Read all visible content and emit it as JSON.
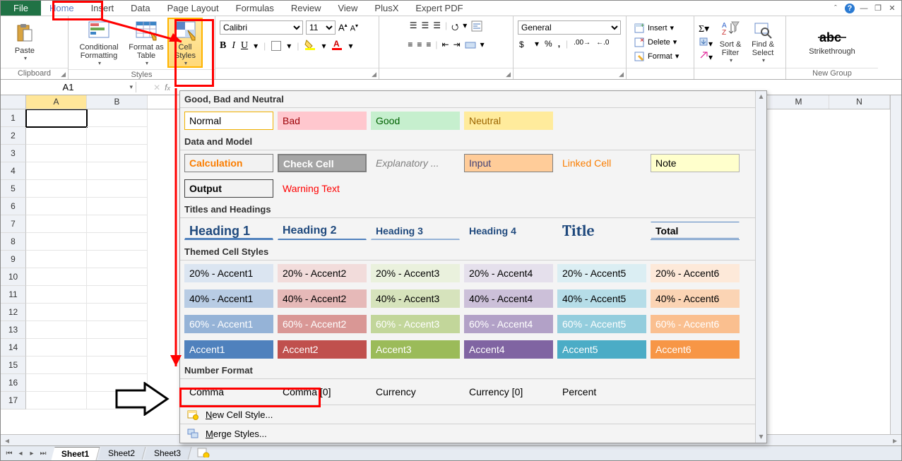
{
  "tabs": {
    "file": "File",
    "items": [
      "Home",
      "Insert",
      "Data",
      "Page Layout",
      "Formulas",
      "Review",
      "View",
      "PlusX",
      "Expert PDF"
    ],
    "selected": "Home"
  },
  "ribbon": {
    "clipboard": {
      "paste": "Paste",
      "label": "Clipboard"
    },
    "styles": {
      "conditional": "Conditional Formatting",
      "formatTable": "Format as Table",
      "cellStyles": "Cell Styles",
      "label": "Styles"
    },
    "font": {
      "name": "Calibri",
      "size": "11",
      "bold": "B",
      "italic": "I",
      "underline": "U"
    },
    "number": {
      "format": "General"
    },
    "cells": {
      "insert": "Insert",
      "delete": "Delete",
      "format": "Format"
    },
    "editing": {
      "sortFilter": "Sort & Filter",
      "findSelect": "Find & Select"
    },
    "strike": {
      "label": "Strikethrough",
      "group": "New Group"
    }
  },
  "namebox": "A1",
  "columns": [
    "A",
    "B",
    "M",
    "N"
  ],
  "rows": [
    1,
    2,
    3,
    4,
    5,
    6,
    7,
    8,
    9,
    10,
    11,
    12,
    13,
    14,
    15,
    16,
    17
  ],
  "sheetTabs": {
    "active": "Sheet1",
    "items": [
      "Sheet1",
      "Sheet2",
      "Sheet3"
    ]
  },
  "gallery": {
    "sections": {
      "gbn": {
        "title": "Good, Bad and Neutral",
        "items": [
          "Normal",
          "Bad",
          "Good",
          "Neutral"
        ]
      },
      "dm": {
        "title": "Data and Model",
        "row1": [
          "Calculation",
          "Check Cell",
          "Explanatory ...",
          "Input",
          "Linked Cell",
          "Note"
        ],
        "row2": [
          "Output",
          "Warning Text"
        ]
      },
      "th": {
        "title": "Titles and Headings",
        "items": [
          "Heading 1",
          "Heading 2",
          "Heading 3",
          "Heading 4",
          "Title",
          "Total"
        ]
      },
      "tcs": {
        "title": "Themed Cell Styles",
        "row20": [
          "20% - Accent1",
          "20% - Accent2",
          "20% - Accent3",
          "20% - Accent4",
          "20% - Accent5",
          "20% - Accent6"
        ],
        "row40": [
          "40% - Accent1",
          "40% - Accent2",
          "40% - Accent3",
          "40% - Accent4",
          "40% - Accent5",
          "40% - Accent6"
        ],
        "row60": [
          "60% - Accent1",
          "60% - Accent2",
          "60% - Accent3",
          "60% - Accent4",
          "60% - Accent5",
          "60% - Accent6"
        ],
        "rowA": [
          "Accent1",
          "Accent2",
          "Accent3",
          "Accent4",
          "Accent5",
          "Accent6"
        ]
      },
      "nf": {
        "title": "Number Format",
        "items": [
          "Comma",
          "Comma [0]",
          "Currency",
          "Currency [0]",
          "Percent"
        ]
      }
    },
    "footer": {
      "newStyle_pre": "N",
      "newStyle_post": "ew Cell Style...",
      "merge_pre": "M",
      "merge_post": "erge Styles..."
    }
  }
}
